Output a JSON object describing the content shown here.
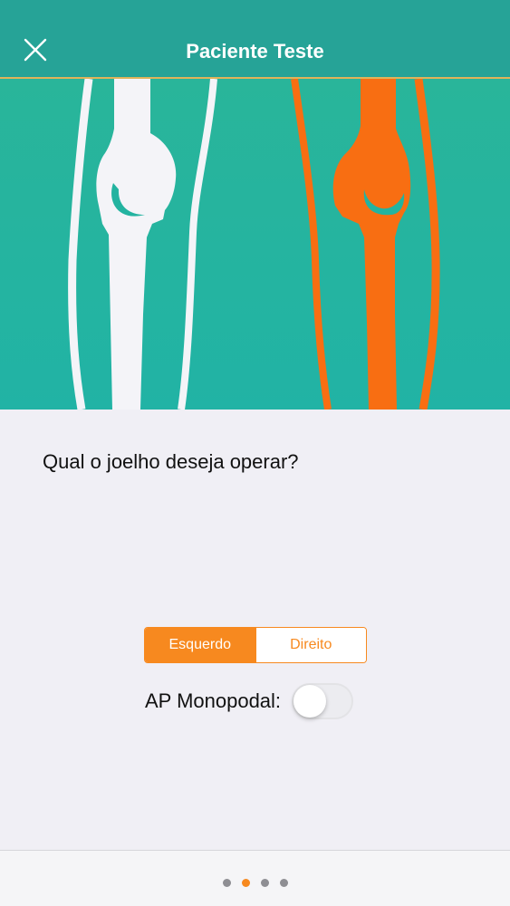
{
  "navbar": {
    "title": "Paciente Teste",
    "close_icon": "close-icon"
  },
  "hero": {
    "illustration": "knee-bones-illustration",
    "colors": {
      "background": "#23b3a0",
      "left_knee": "#f4f4f8",
      "right_knee": "#f86e12"
    }
  },
  "main": {
    "question": "Qual o joelho deseja operar?",
    "segmented": {
      "options": [
        "Esquerdo",
        "Direito"
      ],
      "selected": "Esquerdo"
    },
    "toggle": {
      "label": "AP Monopodal:",
      "on": false
    }
  },
  "pager": {
    "total": 4,
    "current": 2
  },
  "colors": {
    "accent": "#f7891f",
    "navbar": "#26a397",
    "background": "#f0eff5"
  }
}
